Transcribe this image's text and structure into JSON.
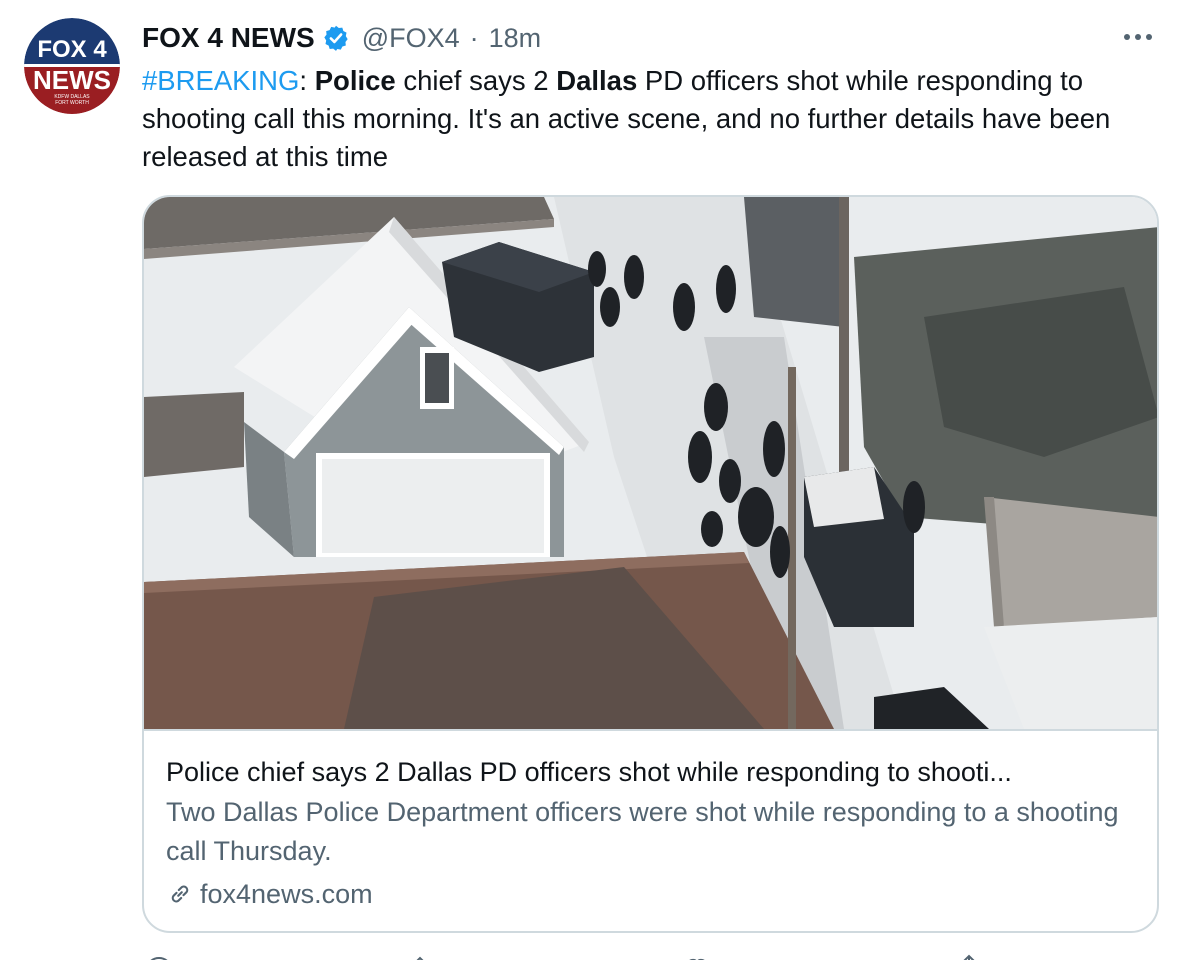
{
  "tweet": {
    "display_name": "FOX 4 NEWS",
    "handle": "@FOX4",
    "separator": "·",
    "time": "18m",
    "verified": true,
    "text": {
      "hashtag": "#BREAKING",
      "colon": ": ",
      "bold1": "Police",
      "seg1": " chief says 2 ",
      "bold2": "Dallas",
      "seg2": " PD officers shot while responding to shooting call this morning. It's an active scene, and no further details have been released at this time"
    }
  },
  "avatar": {
    "logo_lines": [
      "FOX 4",
      "NEWS",
      "KDFW DALLAS",
      "FORT WORTH"
    ]
  },
  "card": {
    "title": "Police chief says 2 Dallas PD officers shot while responding to shooti...",
    "description": "Two Dallas Police Department officers were shot while responding to a shooting call Thursday.",
    "domain": "fox4news.com"
  },
  "icons": {
    "verified": "verified-badge-icon",
    "more": "more-horizontal-icon",
    "link": "link-icon",
    "reply": "reply-icon",
    "retweet": "retweet-icon",
    "like": "like-icon",
    "share": "share-icon"
  },
  "colors": {
    "accent": "#1d9bf0",
    "text": "#0f1419",
    "secondary": "#536471",
    "border": "#cfd9de",
    "brand_blue": "#1c3a72",
    "brand_red": "#9a1e22"
  }
}
